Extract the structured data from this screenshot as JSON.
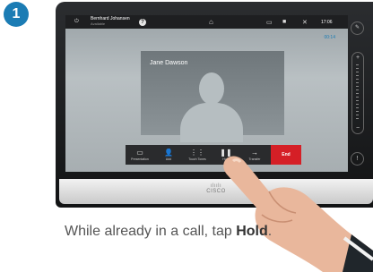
{
  "step_number": "1",
  "status_bar": {
    "user_name": "Bernhard Johansen",
    "user_status": "Available",
    "time": "17:06",
    "icons": [
      "power-icon",
      "help-icon",
      "home-icon",
      "layout-icon",
      "camera-icon",
      "microphone-mute-icon"
    ]
  },
  "call": {
    "duration": "00:14",
    "remote_name": "Jane Dawson"
  },
  "controls": [
    {
      "label": "Presentation",
      "icon": "monitor-icon"
    },
    {
      "label": "Add",
      "icon": "add-user-icon"
    },
    {
      "label": "Touch Tones",
      "icon": "keypad-icon"
    },
    {
      "label": "Hold",
      "icon": "pause-icon"
    },
    {
      "label": "Transfer",
      "icon": "transfer-icon"
    }
  ],
  "end_button": {
    "label": "End",
    "color": "#d51f26"
  },
  "brand": "CISCO",
  "caption": {
    "prefix": "While already in a call, tap ",
    "emphasis": "Hold",
    "suffix": "."
  },
  "colors": {
    "accent": "#1b7cb4",
    "end_red": "#d51f26"
  }
}
